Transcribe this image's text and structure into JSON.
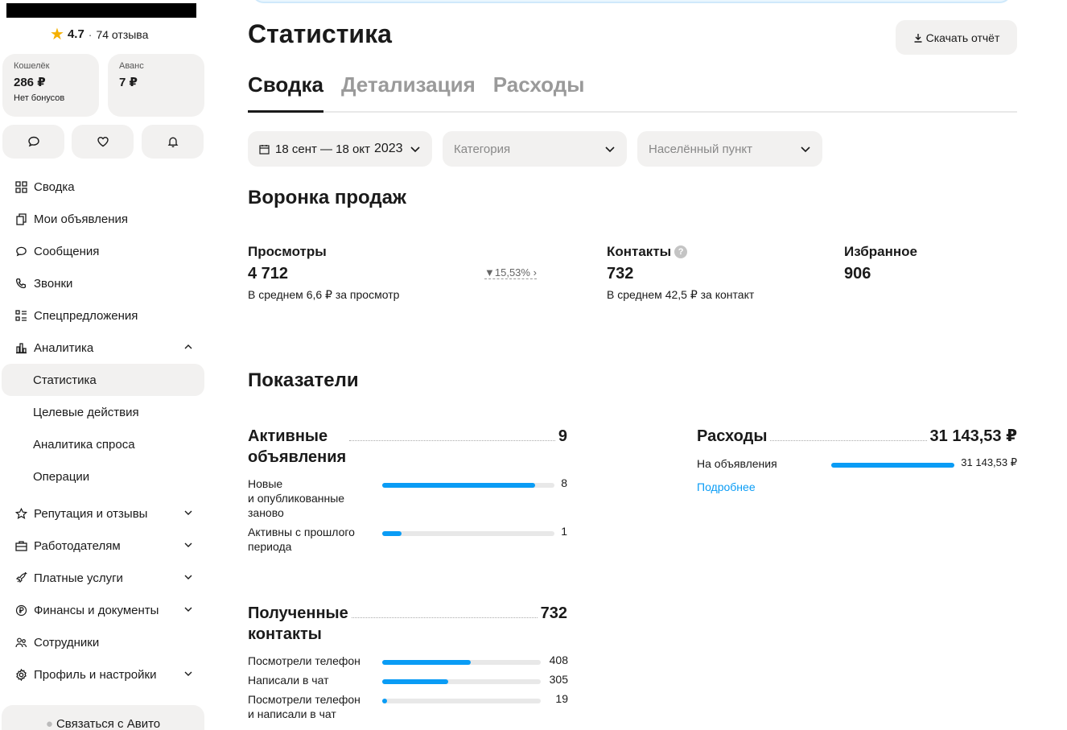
{
  "profile": {
    "rating": "4.7",
    "reviews": "74 отзыва"
  },
  "wallet": {
    "label": "Кошелёк",
    "value": "286 ₽",
    "sub": "Нет бонусов"
  },
  "advance": {
    "label": "Аванс",
    "value": "7 ₽"
  },
  "quick_icons": [
    "chat-icon",
    "heart-icon",
    "bell-icon"
  ],
  "nav": {
    "svodka": "Сводка",
    "ads": "Мои объявления",
    "messages": "Сообщения",
    "calls": "Звонки",
    "offers": "Спецпредложения",
    "analytics": "Аналитика",
    "statistics": "Статистика",
    "target": "Целевые действия",
    "demand": "Аналитика спроса",
    "operations": "Операции",
    "reputation": "Репутация и отзывы",
    "employers": "Работодателям",
    "paid": "Платные услуги",
    "finance": "Финансы и документы",
    "staff": "Сотрудники",
    "profile": "Профиль и настройки"
  },
  "contact_button": "Связаться с Авито",
  "page_title": "Статистика",
  "download_button": "Скачать отчёт",
  "tabs": [
    "Сводка",
    "Детализация",
    "Расходы"
  ],
  "filters": {
    "date": "18 сент — 18 окт",
    "year": "2023",
    "category": "Категория",
    "city": "Населённый пункт"
  },
  "funnel": {
    "title": "Воронка продаж",
    "views": {
      "label": "Просмотры",
      "value": "4 712",
      "sub": "В среднем 6,6 ₽ за просмотр",
      "trend": "15,53%"
    },
    "contacts": {
      "label": "Контакты",
      "value": "732",
      "sub": "В среднем 42,5 ₽ за контакт"
    },
    "favorites": {
      "label": "Избранное",
      "value": "906"
    }
  },
  "indicators": {
    "title": "Показатели",
    "active": {
      "label_line1": "Активные",
      "label_line2": "объявления",
      "total": "9",
      "rows": [
        {
          "label_lines": [
            "Новые",
            "и опубликованные",
            "заново"
          ],
          "value": "8",
          "fraction": 0.889
        },
        {
          "label_lines": [
            "Активны с прошлого",
            "периода"
          ],
          "value": "1",
          "fraction": 0.111
        }
      ]
    },
    "contacts": {
      "label_line1": "Полученные",
      "label_line2": "контакты",
      "total": "732",
      "rows": [
        {
          "label_lines": [
            "Посмотрели телефон"
          ],
          "value": "408",
          "fraction": 0.557
        },
        {
          "label_lines": [
            "Написали в чат"
          ],
          "value": "305",
          "fraction": 0.417
        },
        {
          "label_lines": [
            "Посмотрели телефон",
            "и написали в чат"
          ],
          "value": "19",
          "fraction": 0.026
        }
      ]
    },
    "expenses": {
      "label": "Расходы",
      "total": "31 143,53 ₽",
      "rows": [
        {
          "label": "На объявления",
          "value": "31 143,53 ₽",
          "fraction": 1.0
        }
      ],
      "more_link": "Подробнее"
    }
  },
  "colors": {
    "accent": "#0a9cf5",
    "surface": "#f2f1f0"
  }
}
